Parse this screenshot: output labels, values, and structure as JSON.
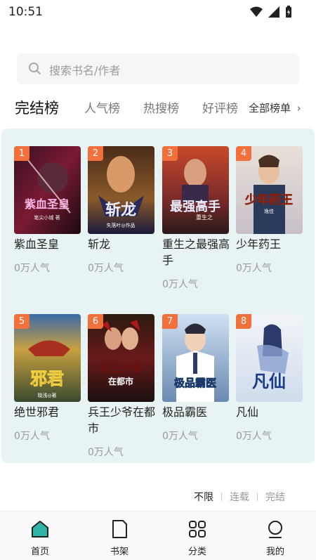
{
  "status_bar": {
    "time": "10:51"
  },
  "search": {
    "placeholder": "搜索书名/作者"
  },
  "tabs": [
    {
      "label": "完结榜",
      "active": true
    },
    {
      "label": "人气榜"
    },
    {
      "label": "热搜榜"
    },
    {
      "label": "好评榜"
    }
  ],
  "all_rankings_label": "全部榜单",
  "books": [
    {
      "rank": "1",
      "title": "紫血圣皇",
      "popularity": "0万人气",
      "cover_text": "紫血圣皇",
      "cover_sub": "笔尖小城 著"
    },
    {
      "rank": "2",
      "title": "斩龙",
      "popularity": "0万人气",
      "cover_text": "斩龙",
      "cover_sub": "失落叶◎作品"
    },
    {
      "rank": "3",
      "title": "重生之最强高手",
      "popularity": "0万人气",
      "cover_text": "最强高手",
      "cover_sub": "重生之"
    },
    {
      "rank": "4",
      "title": "少年药王",
      "popularity": "0万人气",
      "cover_text": "少年药王",
      "cover_sub": "逸佳"
    },
    {
      "rank": "5",
      "title": "绝世邪君",
      "popularity": "0万人气",
      "cover_text": "邪君",
      "cover_sub": "晓浅◎著"
    },
    {
      "rank": "6",
      "title": "兵王少爷在都市",
      "popularity": "0万人气",
      "cover_text": "兵王少爷",
      "cover_sub": "在都市"
    },
    {
      "rank": "7",
      "title": "极品霸医",
      "popularity": "0万人气",
      "cover_text": "极品霸医",
      "cover_sub": ""
    },
    {
      "rank": "8",
      "title": "凡仙",
      "popularity": "0万人气",
      "cover_text": "凡仙",
      "cover_sub": ""
    }
  ],
  "filters": [
    {
      "label": "不限",
      "active": true
    },
    {
      "label": "连载"
    },
    {
      "label": "完结"
    }
  ],
  "bottom_nav": [
    {
      "label": "首页",
      "icon": "home-icon",
      "active": true
    },
    {
      "label": "书架",
      "icon": "bookshelf-icon"
    },
    {
      "label": "分类",
      "icon": "category-icon"
    },
    {
      "label": "我的",
      "icon": "profile-icon"
    }
  ],
  "colors": {
    "accent": "#2fb4a8",
    "rank_badge": "#f2703b",
    "panel_bg": "#e8f3f4"
  }
}
